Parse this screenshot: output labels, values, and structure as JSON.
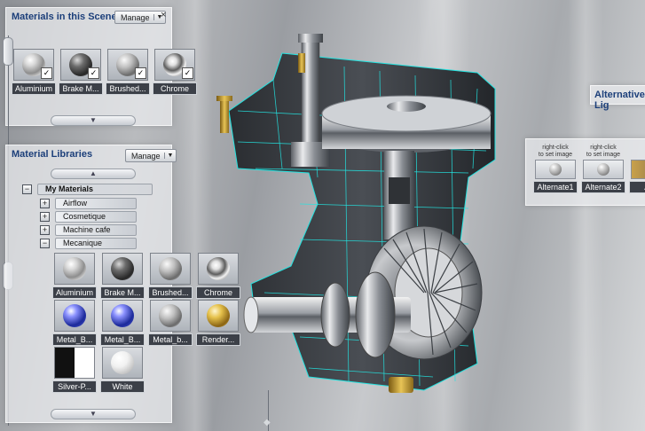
{
  "scene_panel": {
    "title": "Materials in this Scene",
    "manage_label": "Manage",
    "close_glyph": "×",
    "scroll_glyph": "▼",
    "slider_glyph": "◆",
    "materials": [
      {
        "label": "Aluminium",
        "ball": "aluminium",
        "checked": true
      },
      {
        "label": "Brake M...",
        "ball": "brake",
        "checked": true
      },
      {
        "label": "Brushed...",
        "ball": "brushed",
        "checked": true
      },
      {
        "label": "Chrome",
        "ball": "chrome",
        "checked": true
      }
    ]
  },
  "library_panel": {
    "title": "Material Libraries",
    "manage_label": "Manage",
    "close_glyph": "×",
    "scroll_up_glyph": "▲",
    "scroll_down_glyph": "▼",
    "tree": {
      "root": {
        "label": "My Materials",
        "toggle": "−"
      },
      "items": [
        {
          "label": "Airflow",
          "toggle": "+"
        },
        {
          "label": "Cosmetique",
          "toggle": "+"
        },
        {
          "label": "Machine cafe",
          "toggle": "+"
        },
        {
          "label": "Mecanique",
          "toggle": "−"
        }
      ]
    },
    "materials": [
      {
        "label": "Aluminium",
        "ball": "aluminium"
      },
      {
        "label": "Brake M...",
        "ball": "brake"
      },
      {
        "label": "Brushed...",
        "ball": "brushed"
      },
      {
        "label": "Chrome",
        "ball": "chrome"
      },
      {
        "label": "Metal_B...",
        "ball": "blue"
      },
      {
        "label": "Metal_B...",
        "ball": "blue"
      },
      {
        "label": "Metal_b...",
        "ball": "brushed"
      },
      {
        "label": "Render...",
        "ball": "gold"
      },
      {
        "label": "Silver-P...",
        "ball": "silver"
      },
      {
        "label": "White",
        "ball": "white"
      }
    ]
  },
  "alternative_panel": {
    "title": "Alternative Lig",
    "cards": [
      {
        "hint1": "right-click",
        "hint2": "to set image",
        "label": "Alternate1"
      },
      {
        "hint1": "right-click",
        "hint2": "to set image",
        "label": "Alternate2"
      },
      {
        "hint1": "",
        "hint2": "",
        "label": "Alte"
      }
    ]
  },
  "colors": {
    "title_text": "#1c3f7a",
    "label_bg": "#3c4048",
    "wireframe": "#23e3e0"
  }
}
